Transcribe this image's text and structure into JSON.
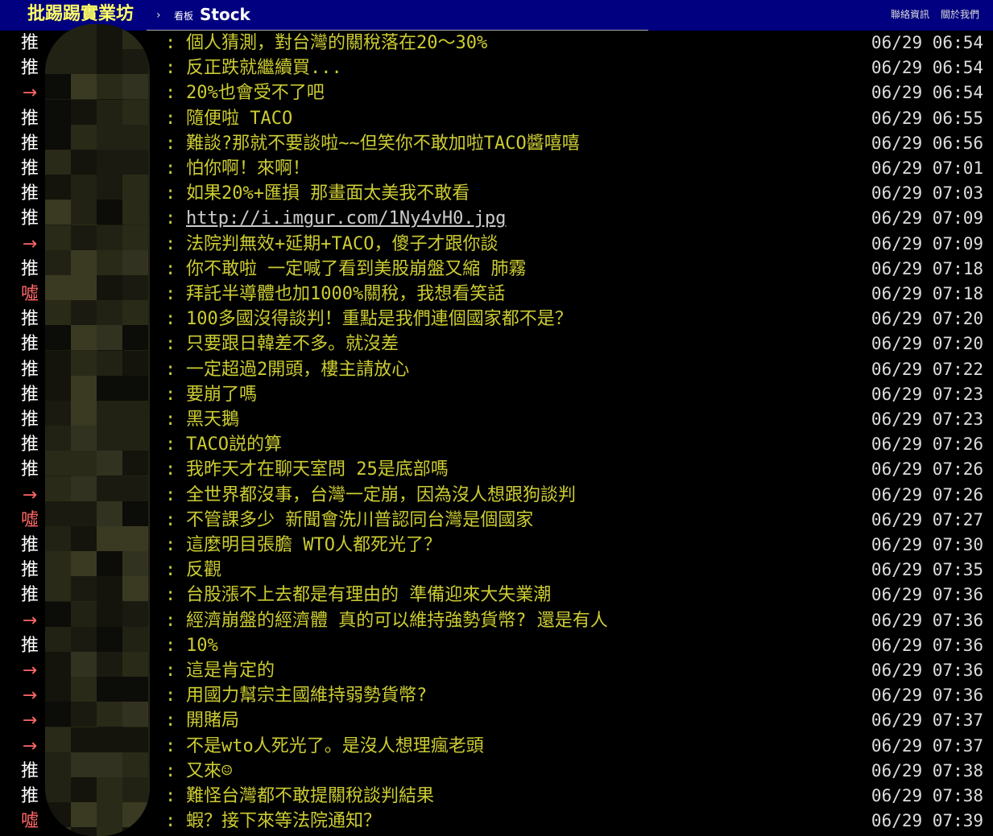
{
  "header": {
    "logo": "批踢踢實業坊",
    "separator": "›",
    "board_prefix": "看板",
    "board_name": "Stock",
    "nav_contact": "聯絡資訊",
    "nav_about": "關於我們"
  },
  "pushes": [
    {
      "tag": "推",
      "type": "push",
      "content": "個人猜測，對台灣的關稅落在20～30%",
      "time": "06/29 06:54"
    },
    {
      "tag": "推",
      "type": "push",
      "content": "反正跌就繼續買...",
      "time": "06/29 06:54"
    },
    {
      "tag": "→",
      "type": "arrow",
      "content": "20%也會受不了吧",
      "time": "06/29 06:54"
    },
    {
      "tag": "推",
      "type": "push",
      "content": "隨便啦 TACO",
      "time": "06/29 06:55"
    },
    {
      "tag": "推",
      "type": "push",
      "content": "難談?那就不要談啦~~但笑你不敢加啦TACO醬嘻嘻",
      "time": "06/29 06:56"
    },
    {
      "tag": "推",
      "type": "push",
      "content": "怕你啊！來啊！",
      "time": "06/29 07:01"
    },
    {
      "tag": "推",
      "type": "push",
      "content": "如果20%+匯損 那畫面太美我不敢看",
      "time": "06/29 07:03"
    },
    {
      "tag": "推",
      "type": "push",
      "content": "http://i.imgur.com/1Ny4vH0.jpg",
      "time": "06/29 07:09",
      "link": true
    },
    {
      "tag": "→",
      "type": "arrow",
      "content": "法院判無效+延期+TACO，傻子才跟你談",
      "time": "06/29 07:09"
    },
    {
      "tag": "推",
      "type": "push",
      "content": "你不敢啦 一定喊了看到美股崩盤又縮  肺霧",
      "time": "06/29 07:18"
    },
    {
      "tag": "噓",
      "type": "boo",
      "content": "拜託半導體也加1000%關稅，我想看笑話",
      "time": "06/29 07:18"
    },
    {
      "tag": "推",
      "type": "push",
      "content": "100多國沒得談判！重點是我們連個國家都不是？",
      "time": "06/29 07:20"
    },
    {
      "tag": "推",
      "type": "push",
      "content": "只要跟日韓差不多。就沒差",
      "time": "06/29 07:20"
    },
    {
      "tag": "推",
      "type": "push",
      "content": "一定超過2開頭，樓主請放心",
      "time": "06/29 07:22"
    },
    {
      "tag": "推",
      "type": "push",
      "content": "要崩了嗎",
      "time": "06/29 07:23"
    },
    {
      "tag": "推",
      "type": "push",
      "content": "黑天鵝",
      "time": "06/29 07:23"
    },
    {
      "tag": "推",
      "type": "push",
      "content": "TACO説的算",
      "time": "06/29 07:26"
    },
    {
      "tag": "推",
      "type": "push",
      "content": "我昨天才在聊天室問 25是底部嗎",
      "time": "06/29 07:26"
    },
    {
      "tag": "→",
      "type": "arrow",
      "content": "全世界都沒事，台灣一定崩，因為沒人想跟狗談判",
      "time": "06/29 07:26"
    },
    {
      "tag": "噓",
      "type": "boo",
      "content": "不管課多少 新聞會洗川普認同台灣是個國家",
      "time": "06/29 07:27"
    },
    {
      "tag": "推",
      "type": "push",
      "content": "這麼明目張膽 WTO人都死光了？",
      "time": "06/29 07:30"
    },
    {
      "tag": "推",
      "type": "push",
      "content": "反觀",
      "time": "06/29 07:35"
    },
    {
      "tag": "推",
      "type": "push",
      "content": "台股漲不上去都是有理由的 準備迎來大失業潮",
      "time": "06/29 07:36"
    },
    {
      "tag": "→",
      "type": "arrow",
      "content": "經濟崩盤的經濟體 真的可以維持強勢貨幣? 還是有人",
      "time": "06/29 07:36"
    },
    {
      "tag": "推",
      "type": "push",
      "content": "10%",
      "time": "06/29 07:36"
    },
    {
      "tag": "→",
      "type": "arrow",
      "content": "這是肯定的",
      "time": "06/29 07:36"
    },
    {
      "tag": "→",
      "type": "arrow",
      "content": "用國力幫宗主國維持弱勢貨幣?",
      "time": "06/29 07:36"
    },
    {
      "tag": "→",
      "type": "arrow",
      "content": "開賭局",
      "time": "06/29 07:37"
    },
    {
      "tag": "→",
      "type": "arrow",
      "content": "不是wto人死光了。是沒人想理瘋老頭",
      "time": "06/29 07:37"
    },
    {
      "tag": "推",
      "type": "push",
      "content": "又來☺",
      "time": "06/29 07:38"
    },
    {
      "tag": "推",
      "type": "push",
      "content": "難怪台灣都不敢提關稅談判結果",
      "time": "06/29 07:38"
    },
    {
      "tag": "噓",
      "type": "boo",
      "content": "蝦？接下來等法院通知？",
      "time": "06/29 07:39"
    }
  ]
}
